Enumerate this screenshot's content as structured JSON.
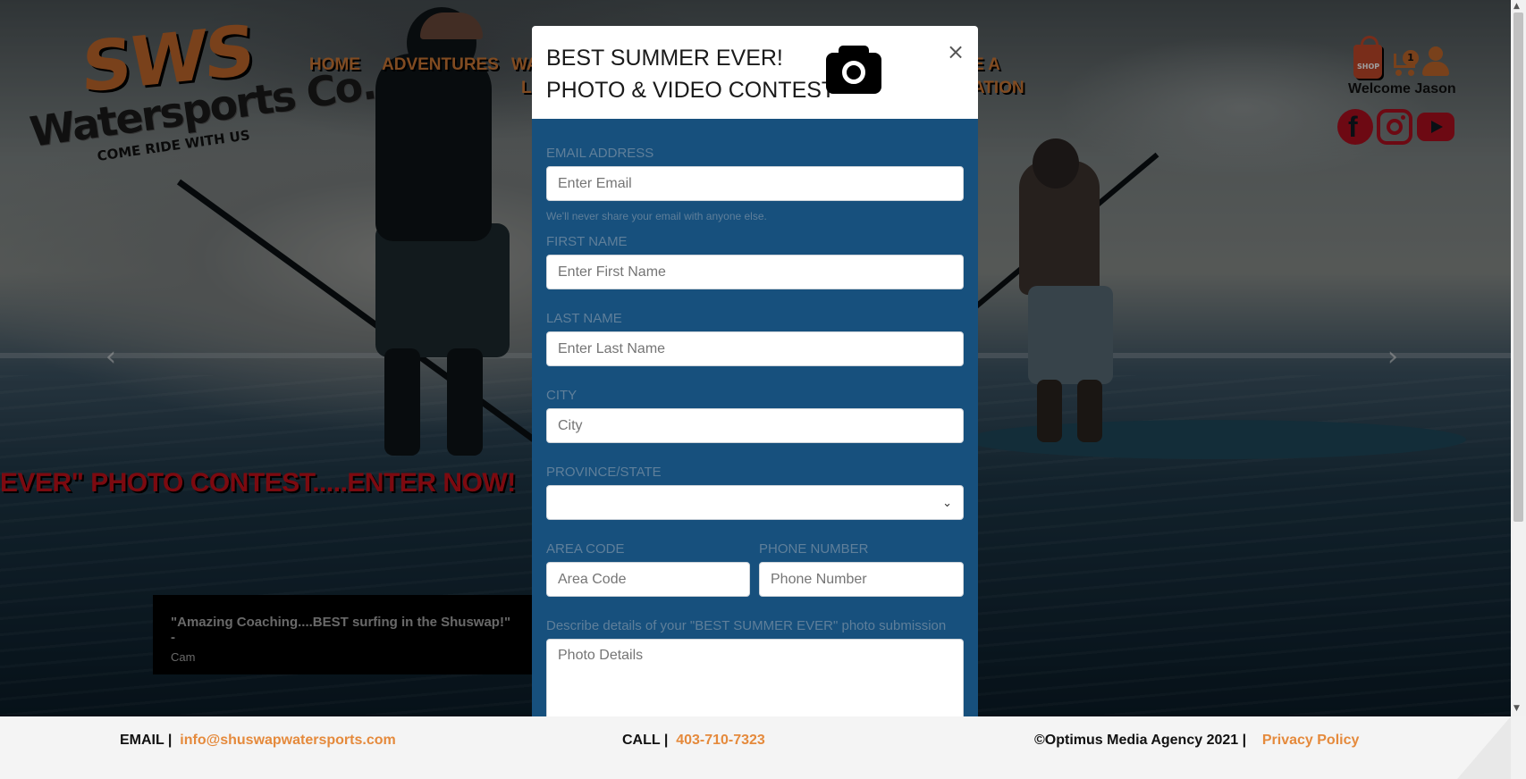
{
  "header": {
    "logo": {
      "main": "SWS",
      "sub": "Watersports Co.",
      "tagline": "COME RIDE WITH US"
    },
    "nav": [
      {
        "label": "HOME"
      },
      {
        "label": "ADVENTURES"
      },
      {
        "label": "WA"
      },
      {
        "label": "L"
      },
      {
        "label": "E A"
      },
      {
        "label": "ATION"
      }
    ],
    "shop_icon_label": "SHOP",
    "cart_count": "1",
    "welcome": "Welcome Jason"
  },
  "hero": {
    "promo": "EVER\" PHOTO CONTEST.....ENTER NOW!",
    "testimonial": {
      "quote": "\"Amazing Coaching....BEST surfing in the Shuswap!\" -",
      "author": "Cam"
    },
    "prev_glyph": "‹",
    "next_glyph": "›"
  },
  "modal": {
    "title_line1": "BEST SUMMER EVER!",
    "title_line2": "PHOTO & VIDEO CONTEST",
    "close_glyph": "×",
    "fields": {
      "email": {
        "label": "EMAIL ADDRESS",
        "placeholder": "Enter Email",
        "help": "We'll never share your email with anyone else."
      },
      "first_name": {
        "label": "FIRST NAME",
        "placeholder": "Enter First Name"
      },
      "last_name": {
        "label": "LAST NAME",
        "placeholder": "Enter Last Name"
      },
      "city": {
        "label": "CITY",
        "placeholder": "City"
      },
      "province": {
        "label": "PROVINCE/STATE",
        "value": ""
      },
      "area_code": {
        "label": "AREA CODE",
        "placeholder": "Area Code"
      },
      "phone": {
        "label": "PHONE NUMBER",
        "placeholder": "Phone Number"
      },
      "details": {
        "label": "Describe details of your \"BEST SUMMER EVER\" photo submission",
        "placeholder": "Photo Details"
      }
    }
  },
  "footer": {
    "email_label": "EMAIL |",
    "email_value": "info@shuswapwatersports.com",
    "call_label": "CALL |",
    "call_value": "403-710-7323",
    "copyright": "©Optimus Media Agency 2021 |",
    "privacy": "Privacy Policy"
  },
  "colors": {
    "accent_orange": "#d07a36",
    "modal_blue": "#17507d",
    "promo_red": "#c8111b",
    "social_red": "#b01020"
  },
  "icons": [
    "shop-icon",
    "cart-icon",
    "user-icon",
    "facebook-icon",
    "instagram-icon",
    "youtube-icon",
    "camera-icon",
    "close-icon",
    "chevron-down-icon",
    "chevron-left-icon",
    "chevron-right-icon"
  ]
}
